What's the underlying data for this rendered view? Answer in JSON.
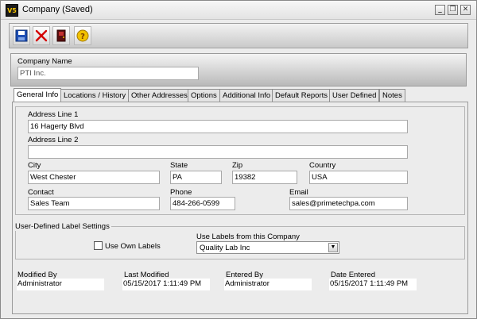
{
  "window": {
    "title": "Company (Saved)",
    "app_icon_text": "V5",
    "controls": {
      "minimize": "_",
      "restore": "❐",
      "close": "✕"
    }
  },
  "toolbar": {
    "buttons": [
      {
        "name": "save-button",
        "icon": "floppy-disk-icon"
      },
      {
        "name": "delete-button",
        "icon": "red-x-icon"
      },
      {
        "name": "exit-button",
        "icon": "door-icon"
      },
      {
        "name": "help-button",
        "icon": "help-icon",
        "glyph": "?"
      }
    ]
  },
  "header": {
    "company_name_label": "Company Name",
    "company_name_value": "PTI Inc."
  },
  "tabs": [
    {
      "label": "General Info",
      "active": true
    },
    {
      "label": "Locations / History"
    },
    {
      "label": "Other Addresses"
    },
    {
      "label": "Options"
    },
    {
      "label": "Additional Info"
    },
    {
      "label": "Default Reports"
    },
    {
      "label": "User Defined"
    },
    {
      "label": "Notes"
    }
  ],
  "general": {
    "address1_label": "Address Line 1",
    "address1_value": "16 Hagerty Blvd",
    "address2_label": "Address Line 2",
    "address2_value": "",
    "city_label": "City",
    "city_value": "West Chester",
    "state_label": "State",
    "state_value": "PA",
    "zip_label": "Zip",
    "zip_value": "19382",
    "country_label": "Country",
    "country_value": "USA",
    "contact_label": "Contact",
    "contact_value": "Sales Team",
    "phone_label": "Phone",
    "phone_value": "484-266-0599",
    "email_label": "Email",
    "email_value": "sales@primetechpa.com"
  },
  "labels_group": {
    "legend": "User-Defined Label Settings",
    "use_own_label": "Use Own Labels",
    "use_own_checked": false,
    "from_company_label": "Use Labels from this Company",
    "from_company_value": "Quality Lab Inc"
  },
  "audit": {
    "modified_by_label": "Modified By",
    "modified_by_value": "Administrator",
    "last_modified_label": "Last Modified",
    "last_modified_value": "05/15/2017 1:11:49 PM",
    "entered_by_label": "Entered By",
    "entered_by_value": "Administrator",
    "date_entered_label": "Date Entered",
    "date_entered_value": "05/15/2017 1:11:49 PM"
  },
  "colors": {
    "window_bg": "#ececec",
    "delete_red": "#d40000",
    "save_blue": "#1f4fb5",
    "help_yellow": "#f2c200"
  }
}
